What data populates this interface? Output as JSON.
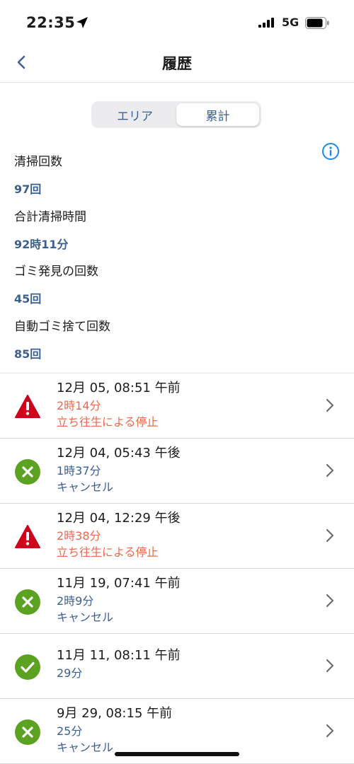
{
  "status_bar": {
    "time": "22:35",
    "network": "5G"
  },
  "nav": {
    "title": "履歴"
  },
  "tabs": [
    {
      "label": "エリア",
      "active": false
    },
    {
      "label": "累計",
      "active": true
    }
  ],
  "stats": [
    {
      "label": "清掃回数",
      "value": "97回"
    },
    {
      "label": "合計清掃時間",
      "value": "92時11分"
    },
    {
      "label": "ゴミ発見の回数",
      "value": "45回"
    },
    {
      "label": "自動ゴミ捨て回数",
      "value": "85回"
    }
  ],
  "history": [
    {
      "date": "12月 05, 08:51 午前",
      "duration": "2時14分",
      "status": "立ち往生による停止",
      "icon": "warning-icon"
    },
    {
      "date": "12月 04, 05:43 午後",
      "duration": "1時37分",
      "status": "キャンセル",
      "icon": "cancel-icon"
    },
    {
      "date": "12月 04, 12:29 午後",
      "duration": "2時38分",
      "status": "立ち往生による停止",
      "icon": "warning-icon"
    },
    {
      "date": "11月 19, 07:41 午前",
      "duration": "2時9分",
      "status": "キャンセル",
      "icon": "cancel-icon"
    },
    {
      "date": "11月 11, 08:11 午前",
      "duration": "29分",
      "status": "",
      "icon": "check-icon"
    },
    {
      "date": "9月 29, 08:15 午前",
      "duration": "25分",
      "status": "キャンセル",
      "icon": "cancel-icon"
    }
  ],
  "colors": {
    "accent_blue": "#3c5f92",
    "alert_red": "#e96a4f",
    "warning_icon_red": "#d0021b",
    "success_green": "#5aa21f",
    "info_blue": "#1e88e5"
  }
}
